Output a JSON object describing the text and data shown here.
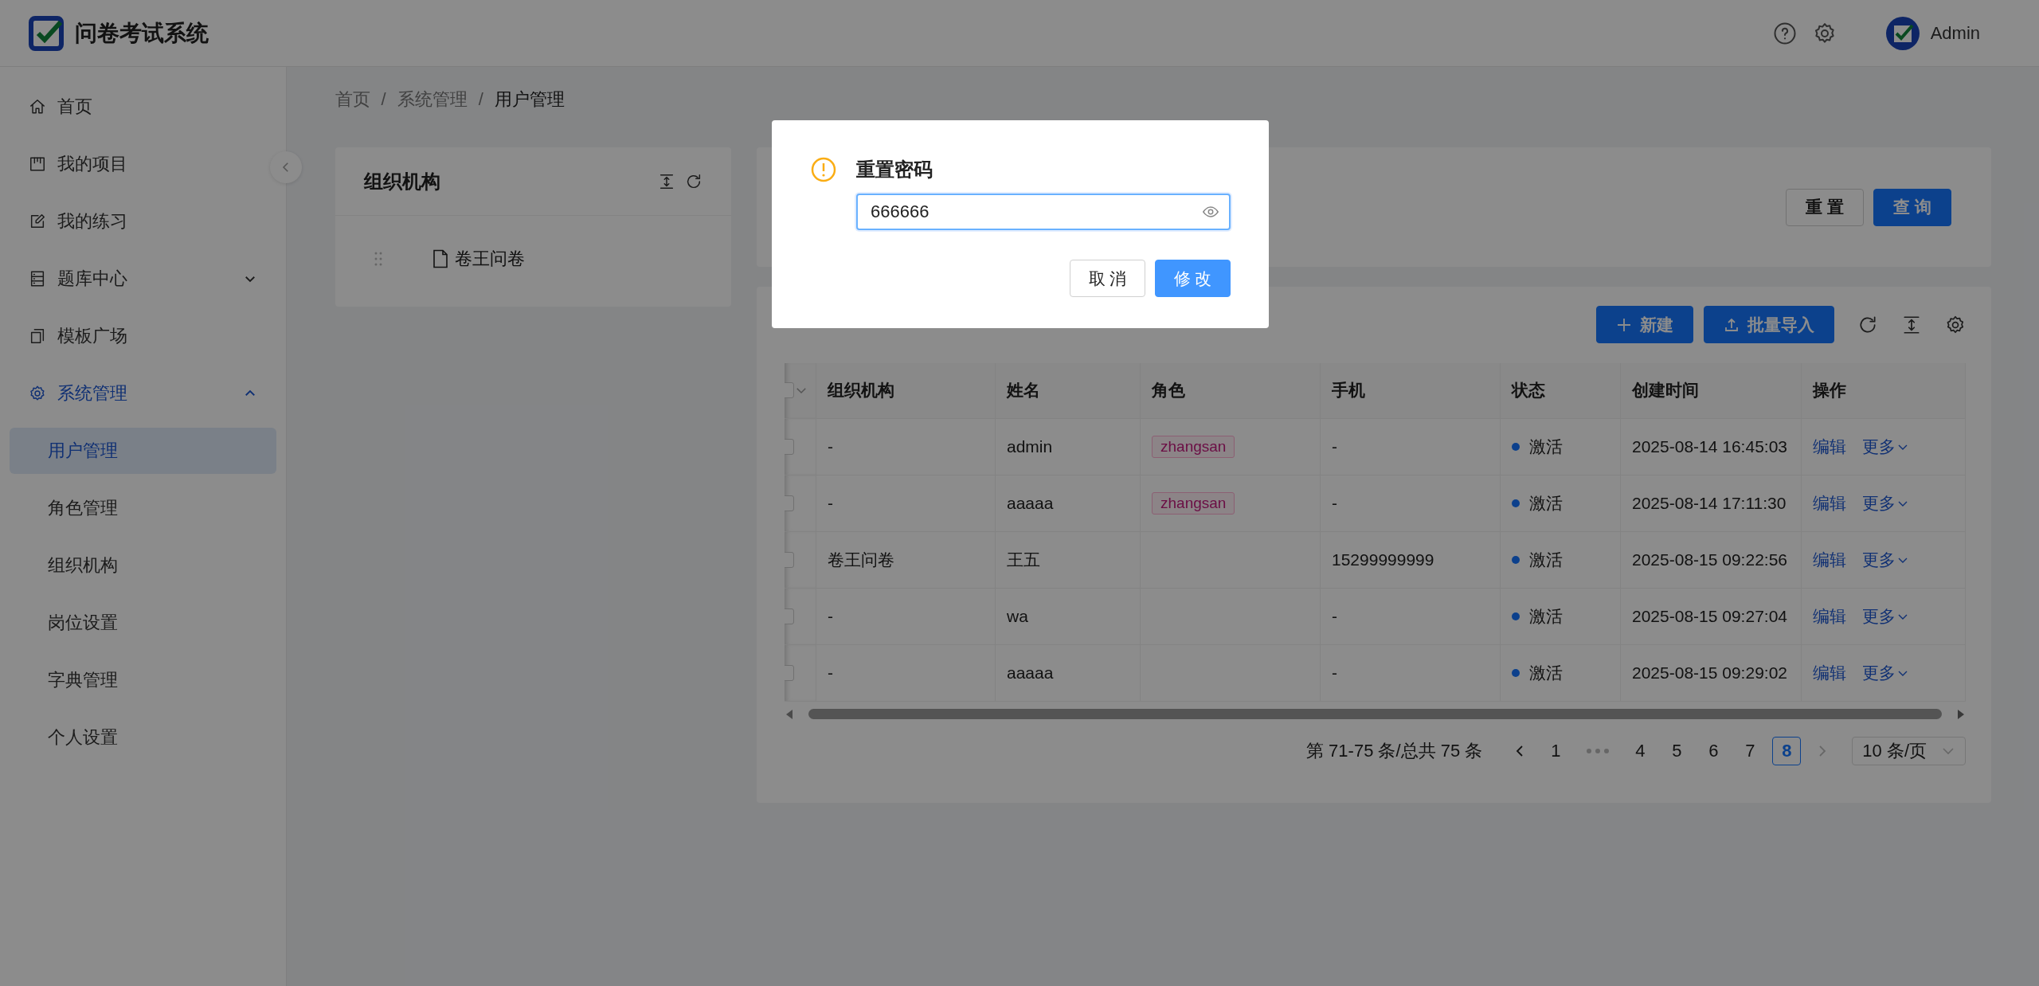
{
  "header": {
    "title": "问卷考试系统",
    "user_name": "Admin"
  },
  "sidebar": {
    "items": [
      {
        "label": "首页",
        "kind": "link",
        "selected": false
      },
      {
        "label": "我的项目",
        "kind": "link",
        "selected": false
      },
      {
        "label": "我的练习",
        "kind": "link",
        "selected": false
      },
      {
        "label": "题库中心",
        "kind": "group",
        "expanded": false,
        "selected": false
      },
      {
        "label": "模板广场",
        "kind": "link",
        "selected": false
      },
      {
        "label": "系统管理",
        "kind": "group",
        "expanded": true,
        "selected": true,
        "children": [
          {
            "label": "用户管理",
            "selected": true
          },
          {
            "label": "角色管理",
            "selected": false
          },
          {
            "label": "组织机构",
            "selected": false
          },
          {
            "label": "岗位设置",
            "selected": false
          },
          {
            "label": "字典管理",
            "selected": false
          },
          {
            "label": "个人设置",
            "selected": false
          }
        ]
      }
    ]
  },
  "breadcrumb": [
    {
      "label": "首页",
      "separator": "/"
    },
    {
      "label": "系统管理",
      "separator": "/"
    },
    {
      "label": "用户管理"
    }
  ],
  "org_panel": {
    "title": "组织机构",
    "tree": [
      {
        "label": "卷王问卷"
      }
    ]
  },
  "search_form": {
    "buttons": [
      {
        "label": "重 置",
        "kind": "default"
      },
      {
        "label": "查 询",
        "kind": "primary"
      }
    ]
  },
  "user_table": {
    "toolbar": [
      {
        "label": "新建",
        "kind": "add"
      },
      {
        "label": "批量导入",
        "kind": "import"
      }
    ],
    "select_all": {
      "checked": false
    },
    "columns": [
      "组织机构",
      "姓名",
      "角色",
      "手机",
      "状态",
      "创建时间",
      "操作"
    ],
    "rows": [
      {
        "checked": false,
        "org": "-",
        "name": "admin",
        "roles": [
          "zhangsan"
        ],
        "phone": "-",
        "status": {
          "label": "激活",
          "color": "#0c418c"
        },
        "created": "2025-08-14 16:45:03",
        "actions": [
          "编辑",
          "更多"
        ]
      },
      {
        "checked": false,
        "org": "-",
        "name": "aaaaa",
        "roles": [
          "zhangsan"
        ],
        "phone": "-",
        "status": {
          "label": "激活",
          "color": "#0c418c"
        },
        "created": "2025-08-14 17:11:30",
        "actions": [
          "编辑",
          "更多"
        ]
      },
      {
        "checked": false,
        "org": "卷王问卷",
        "name": "王五",
        "roles": [],
        "phone": "15299999999",
        "status": {
          "label": "激活",
          "color": "#0c418c"
        },
        "created": "2025-08-15 09:22:56",
        "actions": [
          "编辑",
          "更多"
        ]
      },
      {
        "checked": false,
        "org": "-",
        "name": "wa",
        "roles": [],
        "phone": "-",
        "status": {
          "label": "激活",
          "color": "#0c418c"
        },
        "created": "2025-08-15 09:27:04",
        "actions": [
          "编辑",
          "更多"
        ]
      },
      {
        "checked": false,
        "org": "-",
        "name": "aaaaa",
        "roles": [],
        "phone": "-",
        "status": {
          "label": "激活",
          "color": "#0c418c"
        },
        "created": "2025-08-15 09:29:02",
        "actions": [
          "编辑",
          "更多"
        ]
      }
    ]
  },
  "pagination": {
    "summary": "第 71-75 条/总共 75 条",
    "pages": [
      {
        "kind": "page",
        "label": "1",
        "selected": false
      },
      {
        "kind": "ellipsis",
        "selected": false
      },
      {
        "kind": "page",
        "label": "4",
        "selected": false
      },
      {
        "kind": "page",
        "label": "5",
        "selected": false
      },
      {
        "kind": "page",
        "label": "6",
        "selected": false
      },
      {
        "kind": "page",
        "label": "7",
        "selected": false
      },
      {
        "kind": "page",
        "label": "8",
        "selected": true
      }
    ],
    "page_size": "10 条/页"
  },
  "modal": {
    "title": "重置密码",
    "password": "666666",
    "buttons": [
      {
        "label": "取 消",
        "kind": "default"
      },
      {
        "label": "修 改",
        "kind": "primary"
      }
    ]
  }
}
